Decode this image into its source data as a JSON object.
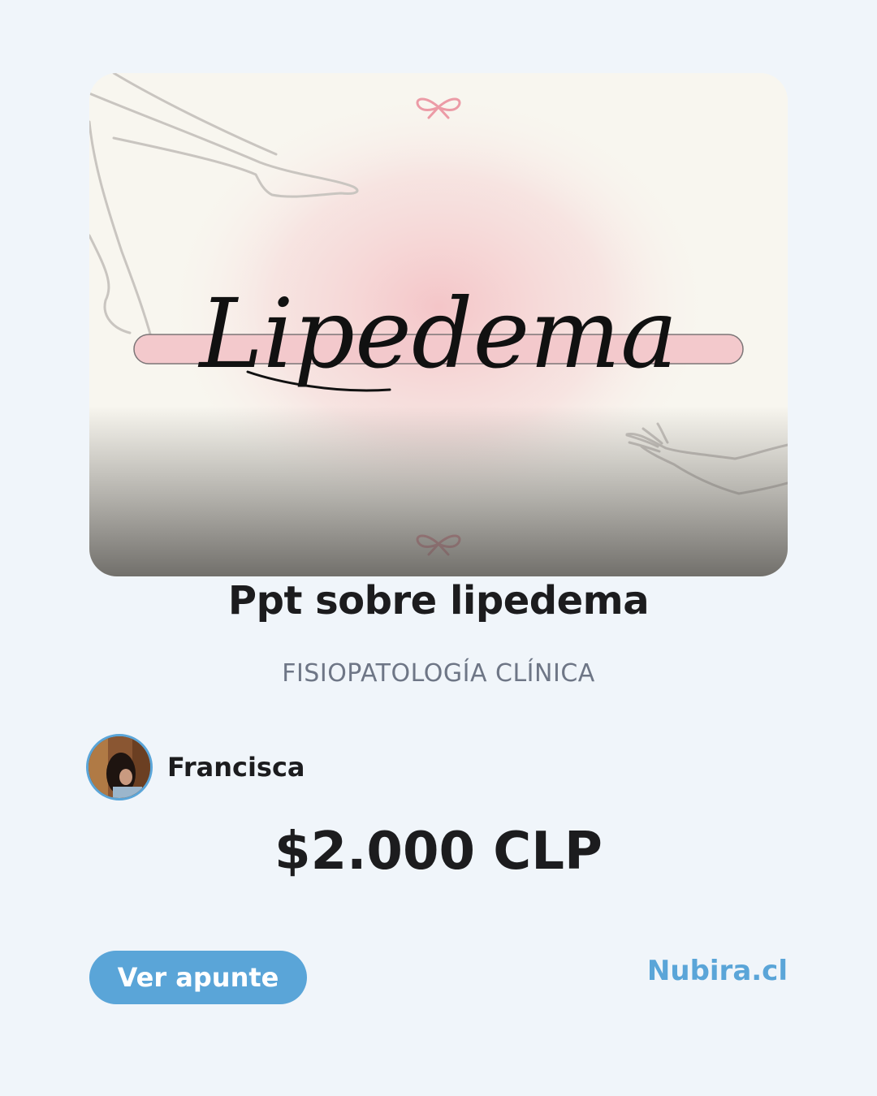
{
  "cover": {
    "word": "Lipedema",
    "accent": "#f3c9cc"
  },
  "listing": {
    "title": "Ppt sobre lipedema",
    "subject": "FISIOPATOLOGÍA CLÍNICA",
    "author": "Francisca",
    "price": "$2.000 CLP"
  },
  "actions": {
    "view_label": "Ver apunte"
  },
  "brand": {
    "name": "Nubira.cl",
    "color": "#5aa5d8"
  },
  "icons": {
    "avatar": "user-photo"
  }
}
